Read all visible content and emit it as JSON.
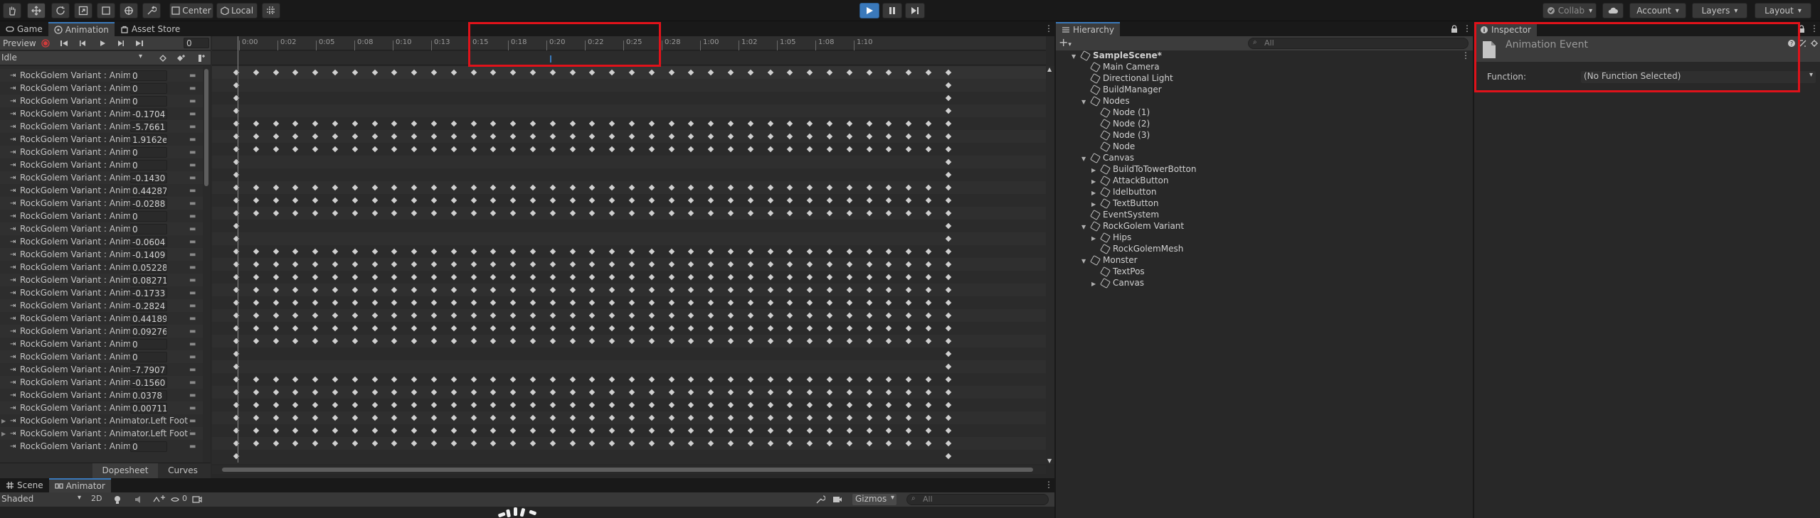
{
  "toolbar": {
    "center_label": "Center",
    "local_label": "Local",
    "collab_label": "Collab",
    "account_label": "Account",
    "layers_label": "Layers",
    "layout_label": "Layout"
  },
  "animation_panel": {
    "tabs": [
      {
        "label": "Game"
      },
      {
        "label": "Animation"
      },
      {
        "label": "Asset Store"
      }
    ],
    "preview_label": "Preview",
    "frame_value": "0",
    "clip_name": "Idle",
    "ruler_labels": [
      "0:00",
      "0:02",
      "0:05",
      "0:08",
      "0:10",
      "0:13",
      "0:15",
      "0:18",
      "0:20",
      "0:22",
      "0:25",
      "0:28",
      "1:00",
      "1:02",
      "1:05",
      "1:08",
      "1:10"
    ],
    "properties": [
      {
        "name": "RockGolem Variant : Animator.",
        "value": "0"
      },
      {
        "name": "RockGolem Variant : Animator.",
        "value": "0"
      },
      {
        "name": "RockGolem Variant : Animator.",
        "value": "0"
      },
      {
        "name": "RockGolem Variant : Animator.",
        "value": "-0.1704"
      },
      {
        "name": "RockGolem Variant : Animator.",
        "value": "-5.7661"
      },
      {
        "name": "RockGolem Variant : Animator.",
        "value": "1.9162e"
      },
      {
        "name": "RockGolem Variant : Animator.",
        "value": "0"
      },
      {
        "name": "RockGolem Variant : Animator.",
        "value": "0"
      },
      {
        "name": "RockGolem Variant : Animator.",
        "value": "-0.1430"
      },
      {
        "name": "RockGolem Variant : Animator.",
        "value": "0.44287"
      },
      {
        "name": "RockGolem Variant : Animator.",
        "value": "-0.0288"
      },
      {
        "name": "RockGolem Variant : Animator.",
        "value": "0"
      },
      {
        "name": "RockGolem Variant : Animator.",
        "value": "0"
      },
      {
        "name": "RockGolem Variant : Animator.",
        "value": "-0.0604"
      },
      {
        "name": "RockGolem Variant : Animator.",
        "value": "-0.1409"
      },
      {
        "name": "RockGolem Variant : Animator.",
        "value": "0.05228"
      },
      {
        "name": "RockGolem Variant : Animator.",
        "value": "0.08271"
      },
      {
        "name": "RockGolem Variant : Animator.",
        "value": "-0.1733"
      },
      {
        "name": "RockGolem Variant : Animator.",
        "value": "-0.2824"
      },
      {
        "name": "RockGolem Variant : Animator.",
        "value": "0.44189"
      },
      {
        "name": "RockGolem Variant : Animator.",
        "value": "0.09276"
      },
      {
        "name": "RockGolem Variant : Animator.",
        "value": "0"
      },
      {
        "name": "RockGolem Variant : Animator.",
        "value": "0"
      },
      {
        "name": "RockGolem Variant : Animator.",
        "value": "-7.7907"
      },
      {
        "name": "RockGolem Variant : Animator.",
        "value": "-0.1560"
      },
      {
        "name": "RockGolem Variant : Animator.",
        "value": "0.0378"
      },
      {
        "name": "RockGolem Variant : Animator.",
        "value": "0.00711"
      },
      {
        "name": "RockGolem Variant : Animator.Left Foot Q",
        "value": ""
      },
      {
        "name": "RockGolem Variant : Animator.Left Foot T",
        "value": ""
      },
      {
        "name": "RockGolem Variant : Animator.",
        "value": "0"
      }
    ],
    "dopesheet_label": "Dopesheet",
    "curves_label": "Curves"
  },
  "scene_panel": {
    "tabs": [
      {
        "label": "Scene"
      },
      {
        "label": "Animator"
      }
    ],
    "shading_label": "Shaded",
    "mode_2d_label": "2D",
    "hidden_count": "0",
    "gizmos_label": "Gizmos",
    "search_placeholder": "All"
  },
  "hierarchy": {
    "tab_label": "Hierarchy",
    "search_placeholder": "All",
    "items": [
      {
        "label": "SampleScene*",
        "depth": 0,
        "arrow": "open",
        "icon": "unity-scene-icon"
      },
      {
        "label": "Main Camera",
        "depth": 1,
        "arrow": "none",
        "icon": "cube-icon"
      },
      {
        "label": "Directional Light",
        "depth": 1,
        "arrow": "none",
        "icon": "cube-icon"
      },
      {
        "label": "BuildManager",
        "depth": 1,
        "arrow": "none",
        "icon": "cube-icon"
      },
      {
        "label": "Nodes",
        "depth": 1,
        "arrow": "open",
        "icon": "cube-icon"
      },
      {
        "label": "Node (1)",
        "depth": 2,
        "arrow": "none",
        "icon": "cube-icon"
      },
      {
        "label": "Node (2)",
        "depth": 2,
        "arrow": "none",
        "icon": "cube-icon"
      },
      {
        "label": "Node (3)",
        "depth": 2,
        "arrow": "none",
        "icon": "cube-icon"
      },
      {
        "label": "Node",
        "depth": 2,
        "arrow": "none",
        "icon": "cube-icon"
      },
      {
        "label": "Canvas",
        "depth": 1,
        "arrow": "open",
        "icon": "cube-icon"
      },
      {
        "label": "BuildToTowerBotton",
        "depth": 2,
        "arrow": "closed",
        "icon": "cube-icon"
      },
      {
        "label": "AttackButton",
        "depth": 2,
        "arrow": "closed",
        "icon": "cube-icon"
      },
      {
        "label": "Idelbutton",
        "depth": 2,
        "arrow": "closed",
        "icon": "cube-icon"
      },
      {
        "label": "TextButton",
        "depth": 2,
        "arrow": "closed",
        "icon": "cube-icon"
      },
      {
        "label": "EventSystem",
        "depth": 1,
        "arrow": "none",
        "icon": "cube-icon"
      },
      {
        "label": "RockGolem Variant",
        "depth": 1,
        "arrow": "open",
        "icon": "cube-icon"
      },
      {
        "label": "Hips",
        "depth": 2,
        "arrow": "closed",
        "icon": "cube-icon"
      },
      {
        "label": "RockGolemMesh",
        "depth": 2,
        "arrow": "none",
        "icon": "cube-icon"
      },
      {
        "label": "Monster",
        "depth": 1,
        "arrow": "open",
        "icon": "cube-icon"
      },
      {
        "label": "TextPos",
        "depth": 2,
        "arrow": "none",
        "icon": "cube-icon"
      },
      {
        "label": "Canvas",
        "depth": 2,
        "arrow": "closed",
        "icon": "cube-icon"
      }
    ]
  },
  "inspector": {
    "tab_label": "Inspector",
    "title": "Animation Event",
    "function_label": "Function:",
    "function_value": "(No Function Selected)"
  },
  "colors": {
    "highlight_red": "#e0121a",
    "play_blue": "#3a79bb",
    "record_red": "#d23b3b"
  }
}
